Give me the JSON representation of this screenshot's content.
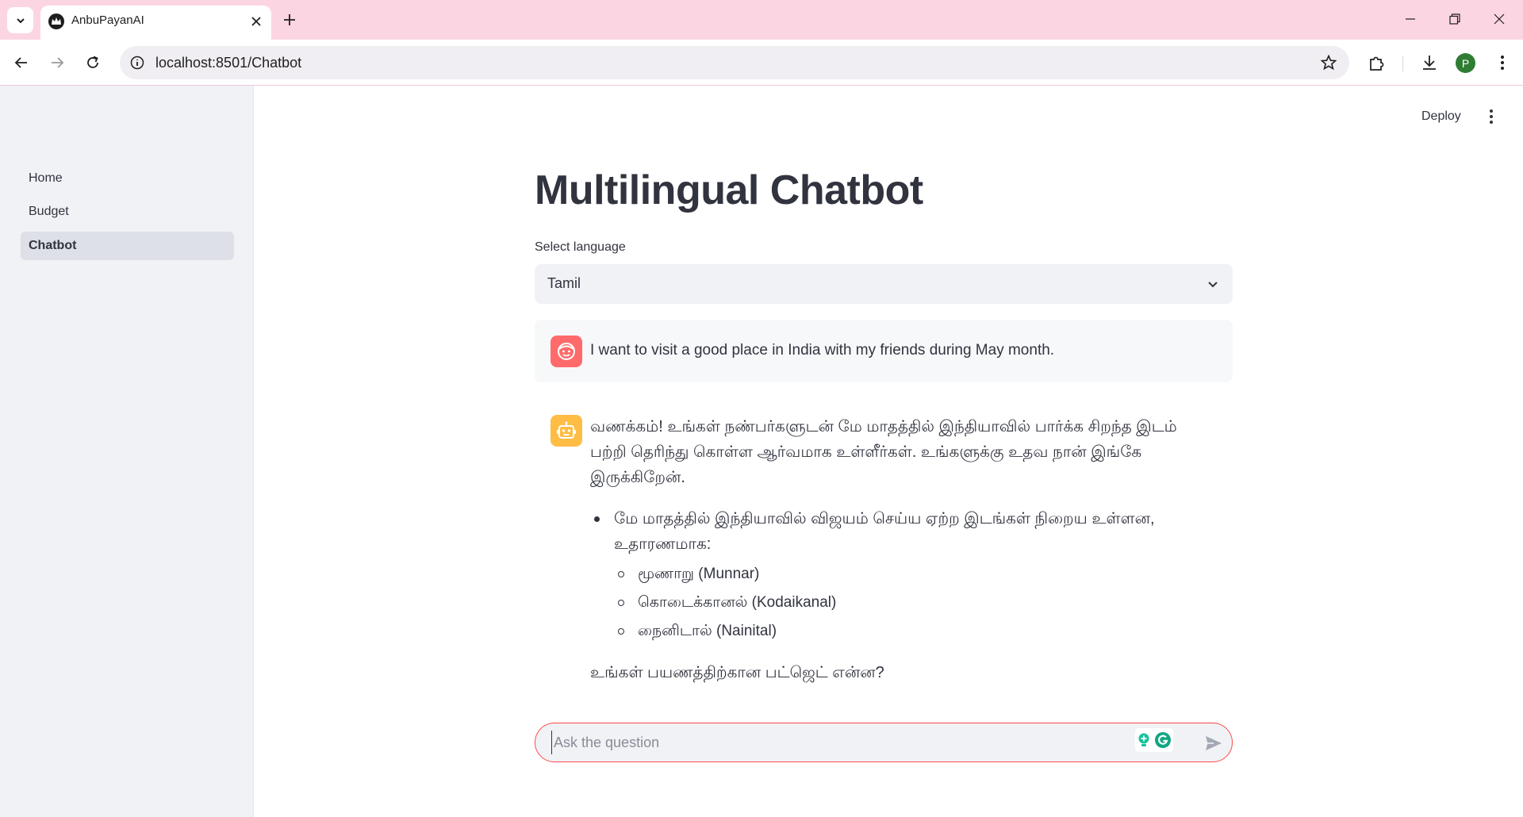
{
  "browser": {
    "tab_title": "AnbuPayanAI",
    "url": "localhost:8501/Chatbot",
    "profile_initial": "P"
  },
  "sidebar": {
    "items": [
      {
        "label": "Home",
        "active": false
      },
      {
        "label": "Budget",
        "active": false
      },
      {
        "label": "Chatbot",
        "active": true
      }
    ]
  },
  "header": {
    "deploy_label": "Deploy"
  },
  "main": {
    "title": "Multilingual Chatbot",
    "select_label": "Select language",
    "selected_language": "Tamil"
  },
  "chat": {
    "user_message": "I want to visit a good place in India with my friends during May month.",
    "bot": {
      "intro": "வணக்கம்! உங்கள் நண்பர்களுடன் மே மாதத்தில் இந்தியாவில் பார்க்க சிறந்த இடம் பற்றி தெரிந்து கொள்ள ஆர்வமாக உள்ளீர்கள். உங்களுக்கு உதவ நான் இங்கே இருக்கிறேன்.",
      "bullet": "மே மாதத்தில் இந்தியாவில் விஜயம் செய்ய ஏற்ற இடங்கள் நிறைய உள்ளன, உதாரணமாக:",
      "places": [
        "மூணாறு (Munnar)",
        "கொடைக்கானல் (Kodaikanal)",
        "நைனிடால் (Nainital)"
      ],
      "question": "உங்கள் பயணத்திற்கான பட்ஜெட் என்ன?"
    },
    "input_placeholder": "Ask the question"
  },
  "colors": {
    "tab_strip": "#fcd5e2",
    "accent": "#ff4b4b",
    "user_avatar": "#ff6b6b",
    "bot_avatar": "#ffbd45",
    "sidebar_bg": "#f0f2f6"
  },
  "icons": {
    "tab_menu": "chevron-down-icon",
    "favicon": "crown-icon",
    "close": "close-icon",
    "new_tab": "plus-icon",
    "back": "arrow-left-icon",
    "forward": "arrow-right-icon",
    "reload": "reload-icon",
    "site_info": "info-icon",
    "bookmark": "star-icon",
    "extensions": "puzzle-icon",
    "downloads": "download-icon",
    "browser_menu": "kebab-menu-icon",
    "app_menu": "kebab-menu-icon",
    "select_chevron": "chevron-down-icon",
    "user_avatar": "smiley-face-icon",
    "bot_avatar": "robot-icon",
    "send": "send-icon"
  }
}
